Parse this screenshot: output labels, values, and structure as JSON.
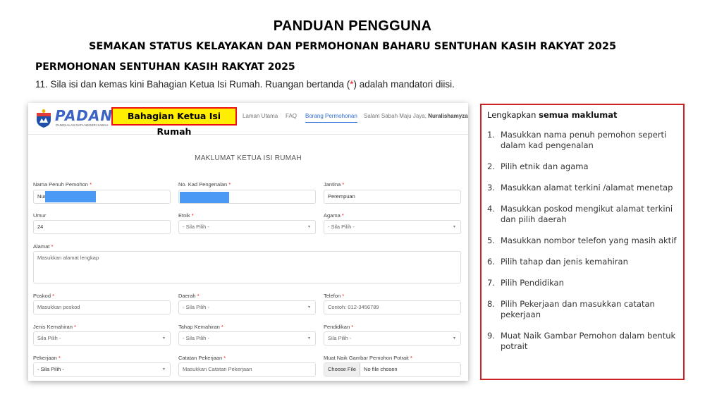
{
  "slide": {
    "title": "PANDUAN PENGGUNA",
    "subtitle": "SEMAKAN STATUS KELAYAKAN DAN PERMOHONAN BAHARU SENTUHAN  KASIH RAKYAT 2025",
    "section_heading": "PERMOHONAN SENTUHAN  KASIH RAKYAT 2025",
    "instruction_before": "11. Sila isi dan kemas kini Bahagian Ketua Isi Rumah. Ruangan bertanda (",
    "instruction_mark": "*",
    "instruction_after": ") adalah mandatori diisi."
  },
  "app": {
    "logo_text": "PADANS",
    "logo_sub": "PANGKALAN DATA NEGERI SABAH",
    "highlight_label": "Bahagian Ketua Isi Rumah",
    "nav": {
      "home": "Laman Utama",
      "faq": "FAQ",
      "form": "Borang Permohonan"
    },
    "greeting": "Salam Sabah Maju Jaya,",
    "username": "Nuralishamyza",
    "colors": {
      "accent": "#2b6cd6",
      "highlight": "#ffee00",
      "border_red": "#e11111"
    }
  },
  "form": {
    "title": "MAKLUMAT KETUA ISI RUMAH",
    "nama_label": "Nama Penuh Pemohon",
    "nama_value": "Nur",
    "ic_label": "No. Kad Pengenalan",
    "jantina_label": "Jantina",
    "jantina_value": "Perempuan",
    "umur_label": "Umur",
    "umur_value": "24",
    "etnik_label": "Etnik",
    "etnik_value": "- Sila Pilih -",
    "agama_label": "Agama",
    "agama_value": "- Sila Pilih -",
    "alamat_label": "Alamat",
    "alamat_placeholder": "Masukkan alamat lengkap",
    "poskod_label": "Poskod",
    "poskod_placeholder": "Masukkan poskod",
    "daerah_label": "Daerah",
    "daerah_value": "- Sila Pilih -",
    "telefon_label": "Telefon",
    "telefon_placeholder": "Contoh: 012-3456789",
    "jenis_label": "Jenis Kemahiran",
    "jenis_value": "Sila Pilih -",
    "tahap_label": "Tahap Kemahiran",
    "tahap_value": "- Sila Pilih -",
    "pendidikan_label": "Pendidikan",
    "pendidikan_value": "Sila Pilih -",
    "pekerjaan_label": "Pekerjaan",
    "pekerjaan_value": "- Sila Pilih -",
    "catatan_label": "Catatan Pekerjaan",
    "catatan_placeholder": "Masukkan Catatan Pekerjaan",
    "gambar_label": "Muat Naik Gambar Pemohon Potrait",
    "file_button": "Choose File",
    "file_status": "No file chosen",
    "required_mark": "*"
  },
  "steps": {
    "intro": "Lengkapkan",
    "intro_bold": "semua maklumat",
    "items": [
      {
        "num": "1.",
        "text": "Masukkan nama penuh pemohon seperti dalam kad pengenalan"
      },
      {
        "num": "2.",
        "text": "Pilih etnik dan agama"
      },
      {
        "num": "3.",
        "text": "Masukkan alamat terkini /alamat menetap"
      },
      {
        "num": "4.",
        "text": "Masukkan poskod mengikut alamat terkini dan pilih daerah"
      },
      {
        "num": "5.",
        "text": "Masukkan nombor telefon yang masih aktif"
      },
      {
        "num": "6.",
        "text": "Pilih tahap dan jenis kemahiran"
      },
      {
        "num": "7.",
        "text": "Pilih Pendidikan"
      },
      {
        "num": "8.",
        "text": "Pilih Pekerjaan dan masukkan catatan pekerjaan"
      },
      {
        "num": "9.",
        "text": "Muat Naik Gambar Pemohon dalam bentuk potrait"
      }
    ]
  }
}
